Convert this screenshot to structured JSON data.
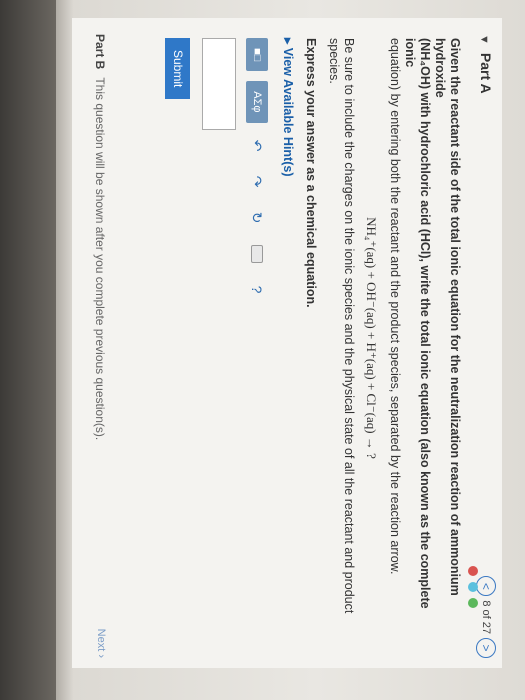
{
  "part_a": {
    "label": "Part A",
    "pager": {
      "text": "8 of 27",
      "prev_icon": "<",
      "next_icon": ">"
    },
    "intro_bold": "Given the reactant side of the total ionic equation for the neutralization reaction of ammonium hydroxide",
    "intro_chem": "(NH₄OH) with hydrochloric acid (HCl), write the total ionic equation (also known as the complete ionic",
    "intro_tail": "equation) by entering both the reactant and the product species, separated by the reaction arrow.",
    "equation": "NH₄⁺(aq) + OH⁻(aq) + H⁺(aq) + Cl⁻(aq) → ?",
    "charges_note": "Be sure to include the charges on the ionic species and the physical state of all the reactant and product species.",
    "express": "Express your answer as a chemical equation.",
    "hints": "View Available Hint(s)",
    "toolbar": {
      "template_label": "■□",
      "greek_label": "AΣφ",
      "undo": "↶",
      "redo": "↷",
      "reset": "↻",
      "help": "?"
    },
    "submit": "Submit"
  },
  "part_b": {
    "label": "Part B",
    "message": "This question will be shown after you complete previous question(s).",
    "next": "Next ›"
  },
  "colors": {
    "accent": "#2f78c8",
    "link": "#1a5fa8",
    "toolbar_btn": "#6f94b8"
  }
}
